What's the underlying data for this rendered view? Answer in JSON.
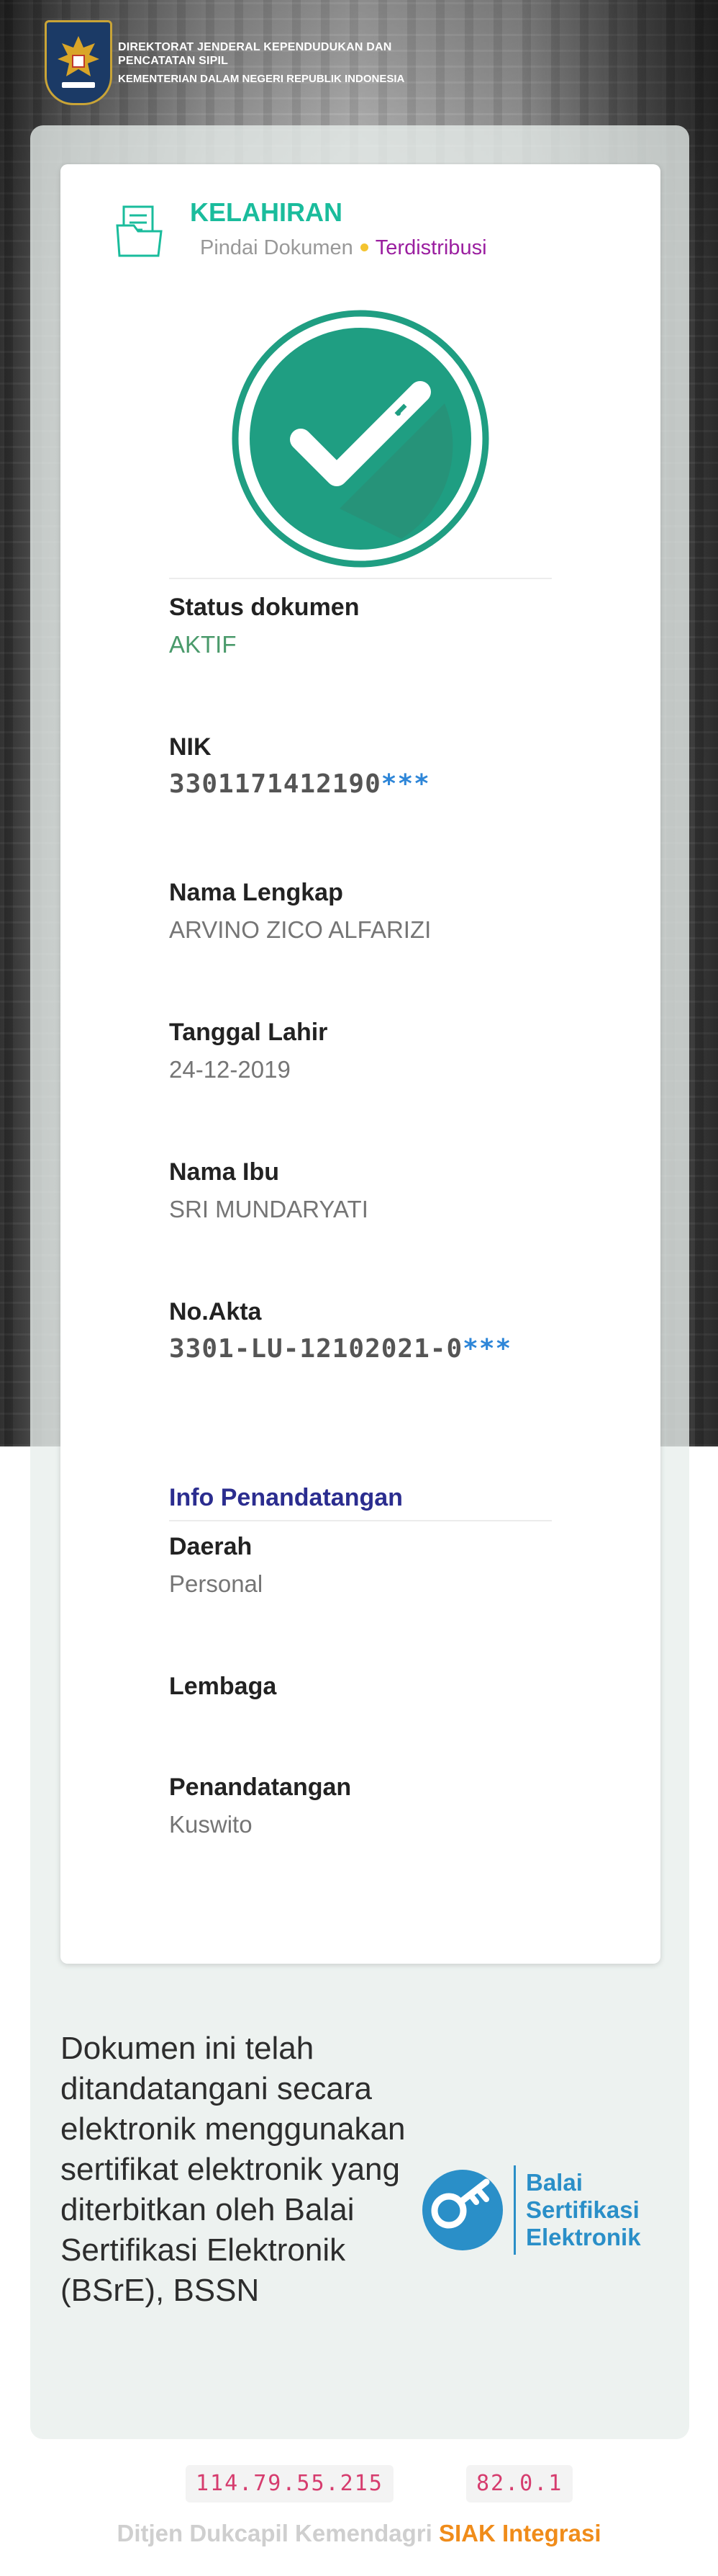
{
  "header": {
    "title": "DIREKTORAT JENDERAL KEPENDUDUKAN DAN PENCATATAN SIPIL",
    "subtitle": "KEMENTERIAN DALAM NEGERI REPUBLIK INDONESIA",
    "logo_icon": "garuda-emblem-icon"
  },
  "document": {
    "title": "KELAHIRAN",
    "scan_label": "Pindai Dokumen",
    "distribution_label": "Terdistribusi",
    "status_icon": "check-circle-icon",
    "colors": {
      "accent": "#1abc9c",
      "check": "#1f9e82",
      "distributed": "#9b1fa0",
      "dot": "#f4c430"
    }
  },
  "fields": {
    "status": {
      "label": "Status dokumen",
      "value": "AKTIF"
    },
    "nik": {
      "label": "NIK",
      "value": "3301171412190",
      "masked": "***"
    },
    "nama": {
      "label": "Nama Lengkap",
      "value": "ARVINO ZICO ALFARIZI"
    },
    "tgl_lahir": {
      "label": "Tanggal Lahir",
      "value": "24-12-2019"
    },
    "nama_ibu": {
      "label": "Nama Ibu",
      "value": "SRI MUNDARYATI"
    },
    "no_akta": {
      "label": "No.Akta",
      "value": "3301-LU-12102021-0",
      "masked": "***"
    }
  },
  "signing": {
    "section_title": "Info Penandatangan",
    "daerah": {
      "label": "Daerah",
      "value": "Personal"
    },
    "lembaga": {
      "label": "Lembaga",
      "value": ""
    },
    "penandatangan": {
      "label": "Penandatangan",
      "value": "Kuswito"
    }
  },
  "bsre": {
    "text": "Dokumen ini telah ditandatangani secara elektronik menggunakan sertifikat elektronik yang diterbitkan oleh Balai Sertifikasi Elektronik (BSrE), BSSN",
    "logo_line1": "Balai",
    "logo_line2": "Sertifikasi",
    "logo_line3": "Elektronik",
    "logo_icon": "bsre-key-icon"
  },
  "footer": {
    "ip": "114.79.55.215",
    "version": "82.0.1",
    "org": "Ditjen Dukcapil Kemendagri",
    "system": "SIAK Integrasi"
  }
}
